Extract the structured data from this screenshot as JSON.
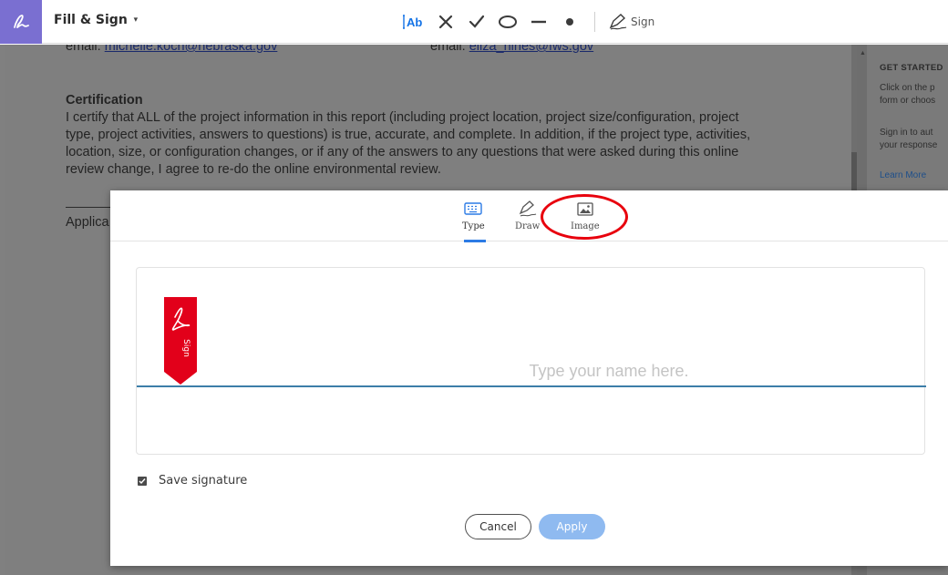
{
  "toolbar": {
    "title": "Fill & Sign",
    "caret": "▾",
    "text_tool": "Ab",
    "sign_label": "Sign"
  },
  "document": {
    "email1_label": "email: ",
    "email1": "michelle.koch@nebraska.gov",
    "email2_label": "email: ",
    "email2": "eliza_hines@fws.gov",
    "cert_heading": "Certification",
    "cert_line1": "I certify that ALL of the project information in this report (including project location, project size/configuration, project",
    "cert_line2": "type, project activities, answers to questions) is true, accurate, and complete.  In addition, if the project type, activities,",
    "cert_line3": "location, size, or configuration changes, or if any of the answers to any questions that were asked during this online",
    "cert_line4": "review change, I agree to re-do the online environmental review.",
    "applicant_partial": "Applica"
  },
  "right_pane": {
    "heading": "GET STARTED",
    "line1a": "Click on the p",
    "line1b": "form or choos",
    "line2a": "Sign in to aut",
    "line2b": "your response",
    "learn_more": "Learn More"
  },
  "modal": {
    "tabs": [
      {
        "label": "Type",
        "icon": "keyboard-icon",
        "active": true
      },
      {
        "label": "Draw",
        "icon": "pen-icon",
        "active": false
      },
      {
        "label": "Image",
        "icon": "image-icon",
        "active": false
      }
    ],
    "flag_text": "Sign",
    "placeholder": "Type your name here.",
    "save_signature_label": "Save signature",
    "save_signature_checked": true,
    "cancel_label": "Cancel",
    "apply_label": "Apply"
  },
  "colors": {
    "accent_blue": "#2c7be5",
    "highlight_red": "#e8000d",
    "apply_disabled": "#8fbaf0",
    "flag_red": "#e2001a"
  }
}
